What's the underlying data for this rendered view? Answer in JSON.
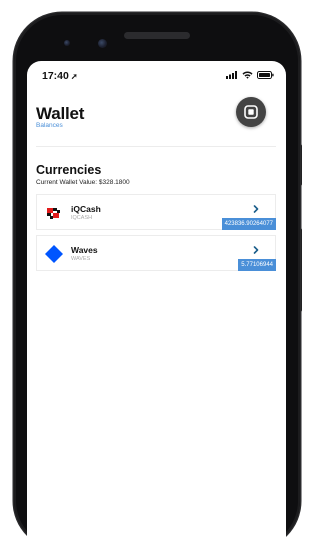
{
  "status_bar": {
    "time": "17:40",
    "location_glyph": "➚",
    "icons": [
      "signal-icon",
      "wifi-icon",
      "battery-icon"
    ]
  },
  "header": {
    "title": "Wallet",
    "subtitle": "Balances",
    "profile_icon": "stop-square-icon"
  },
  "currencies": {
    "title": "Currencies",
    "wallet_value": "Current Wallet Value: $328.1800",
    "items": [
      {
        "name": "iQCash",
        "code": "IQCASH",
        "balance": "423836.90264077",
        "icon": "iqcash-logo-icon"
      },
      {
        "name": "Waves",
        "code": "WAVES",
        "balance": "5.77106944",
        "icon": "waves-diamond-icon"
      }
    ]
  },
  "colors": {
    "accent": "#4a8fd8",
    "waves_blue": "#0055ff",
    "iqcash_red": "#e21b1b"
  }
}
